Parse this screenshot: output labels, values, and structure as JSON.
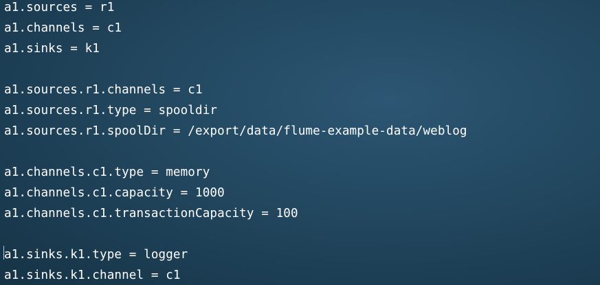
{
  "editor": {
    "lines": [
      "a1.sources = r1",
      "a1.channels = c1",
      "a1.sinks = k1",
      "",
      "a1.sources.r1.channels = c1",
      "a1.sources.r1.type = spooldir",
      "a1.sources.r1.spoolDir = /export/data/flume-example-data/weblog",
      "",
      "a1.channels.c1.type = memory",
      "a1.channels.c1.capacity = 1000",
      "a1.channels.c1.transactionCapacity = 100",
      "",
      "a1.sinks.k1.type = logger",
      "a1.sinks.k1.channel = c1"
    ]
  },
  "theme": {
    "text_color": "#ffffff",
    "background_color": "#22475f"
  }
}
